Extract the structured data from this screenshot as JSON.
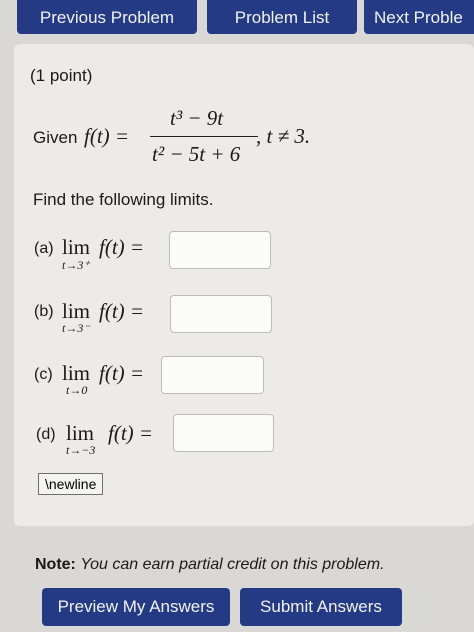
{
  "nav": {
    "previous_label": "Previous Problem",
    "list_label": "Problem List",
    "next_label": "Next Proble"
  },
  "problem": {
    "points": "(1 point)",
    "given_prefix": "Given",
    "func": "f(t) =",
    "numerator": "t³ − 9t",
    "denominator": "t² − 5t + 6",
    "condition": ", t ≠ 3.",
    "instruction": "Find the following limits.",
    "parts": [
      {
        "label": "(a)",
        "lim": "lim",
        "sub": "t→3⁺",
        "expr": "f(t) ="
      },
      {
        "label": "(b)",
        "lim": "lim",
        "sub": "t→3⁻",
        "expr": "f(t) ="
      },
      {
        "label": "(c)",
        "lim": "lim",
        "sub": "t→0",
        "expr": "f(t) ="
      },
      {
        "label": "(d)",
        "lim": "lim",
        "sub": "t→−3",
        "expr": "f(t) ="
      }
    ],
    "newline_label": "\\newline"
  },
  "note": {
    "label": "Note:",
    "text": "You can earn partial credit on this problem."
  },
  "actions": {
    "preview_label": "Preview My Answers",
    "submit_label": "Submit Answers"
  }
}
